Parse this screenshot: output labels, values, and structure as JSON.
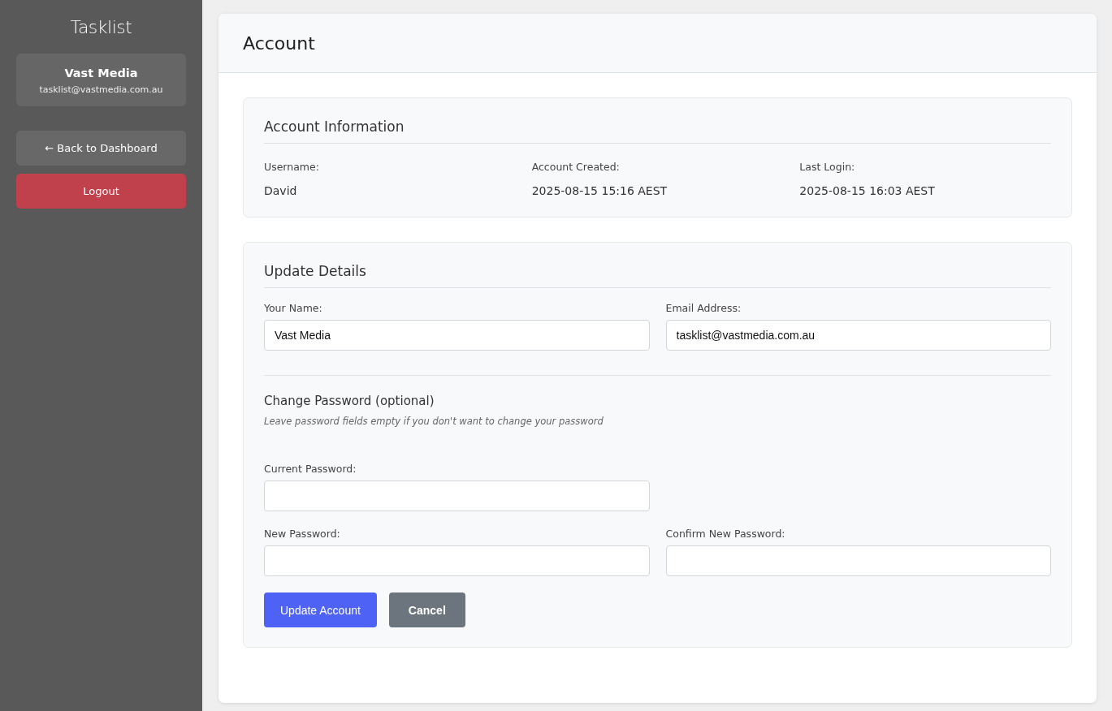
{
  "sidebar": {
    "brand": "Tasklist",
    "user": {
      "name": "Vast Media",
      "email": "tasklist@vastmedia.com.au"
    },
    "buttons": [
      {
        "label": "← Back to Dashboard",
        "kind": "secondary"
      },
      {
        "label": "Logout",
        "kind": "danger"
      }
    ]
  },
  "page": {
    "title": "Account"
  },
  "account_info": {
    "title": "Account Information",
    "items": [
      {
        "label": "Username:",
        "value": "David"
      },
      {
        "label": "Account Created:",
        "value": "2025-08-15 15:16 AEST"
      },
      {
        "label": "Last Login:",
        "value": "2025-08-15 16:03 AEST"
      }
    ]
  },
  "update_details": {
    "title": "Update Details",
    "field_rows": [
      [
        {
          "label": "Your Name:",
          "value": "Vast Media"
        },
        {
          "label": "Email Address:",
          "value": "tasklist@vastmedia.com.au"
        }
      ]
    ],
    "password": {
      "title": "Change Password (optional)",
      "hint": "Leave password fields empty if you don't want to change your password",
      "field_rows": [
        [
          {
            "label": "Current Password:"
          }
        ],
        [
          {
            "label": "New Password:"
          },
          {
            "label": "Confirm New Password:"
          }
        ]
      ]
    },
    "buttons": [
      {
        "label": "Update Account",
        "kind": "primary"
      },
      {
        "label": "Cancel",
        "kind": "secondary"
      }
    ]
  }
}
